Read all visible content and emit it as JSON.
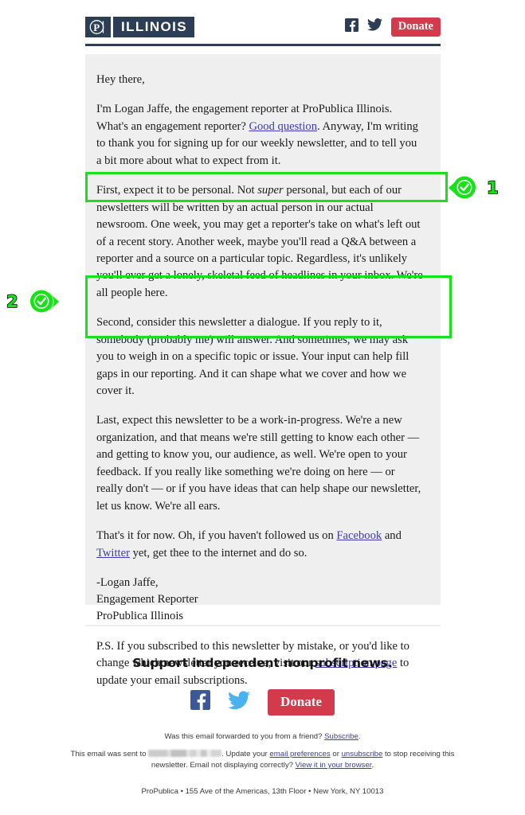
{
  "header": {
    "logo_mark": "propublica-p-logo",
    "logo_word": "ILLINOIS",
    "facebook_icon": "facebook-icon",
    "twitter_icon": "twitter-icon",
    "donate_label": "Donate"
  },
  "letter": {
    "greeting": "Hey there,",
    "p1_a": "I'm Logan Jaffe, the engagement reporter at ProPublica Illinois. What's an engagement reporter? ",
    "p1_link": "Good question",
    "p1_b": ". Anyway, I'm writing to thank you for signing up for our weekly newsletter, and to tell you a bit more about what to expect from it.",
    "p2_a": "First, expect it to be personal. Not ",
    "p2_em": "super",
    "p2_b": " personal, but each of our newsletters will be written by an actual person in our actual newsroom. One week, you may get a reporter's take on what's left out of a recent story. Another week, maybe you'll read a Q&A between a reporter and a source on a particular topic. Regardless, it's unlikely you'll ever get a lonely, skeletal feed of headlines in your inbox. We're all people here.",
    "p3": "Second, consider this newsletter a dialogue. If you reply to it, somebody (probably me) will answer. And sometimes, we may ask you to weigh in on a specific topic or issue. Your input can help fill gaps in our reporting. And it can shape what we cover and how we cover it.",
    "p4": "Last, expect this newsletter to be a work-in-progress. We're a new organization, and that means we're still getting to know each other — and getting to know you, our audience, as well. We're open to your feedback. If you really like something we're doing on here — or really don't — or if you have ideas that can help shape our newsletter, let us know. We're all ears.",
    "p5_a": "That's it for now. Oh, if you haven't followed us on ",
    "p5_fb": "Facebook",
    "p5_and": " and ",
    "p5_tw": "Twitter",
    "p5_b": " yet, get thee to the internet and do so.",
    "sig_name": "-Logan Jaffe,",
    "sig_title": "Engagement Reporter",
    "sig_org": "ProPublica Illinois",
    "ps_a": "P.S. If you subscribed to this newsletter by mistake, or you'd like to change which newsletter you receive, visit our ",
    "ps_link": "subscription page",
    "ps_b": " to update your email subscriptions."
  },
  "annotations": [
    {
      "number": "1",
      "icon": "check-circle-icon",
      "color": "#17e217"
    },
    {
      "number": "2",
      "icon": "check-circle-icon",
      "color": "#17e217"
    }
  ],
  "support": {
    "title": "Support independent nonprofit news.",
    "facebook_icon": "facebook-icon",
    "twitter_icon": "twitter-icon",
    "donate_label": "Donate"
  },
  "fineprint": {
    "line1_a": "Was this email forwarded to you from a friend? ",
    "line1_link": "Subscribe",
    "line1_b": ".",
    "line2_a": "This email was sent to ",
    "line2_redacted": "redacted-email-address",
    "line2_b": ". Update your ",
    "line2_link1": "email preferences",
    "line2_c": " or ",
    "line2_link2": "unsubscribe",
    "line2_d": " to stop receiving this newsletter. Email not displaying correctly? ",
    "line2_link3": "View it in your browser",
    "line2_e": ".",
    "address": "ProPublica • 155 Ave of the Americas, 13th Floor • New York, NY 10013"
  },
  "colors": {
    "navy": "#2c3d56",
    "donate_red": "#d33a4b",
    "panel_gray": "#efefef",
    "link_blue": "#3b3bb3",
    "annotation_green": "#17e217",
    "twitter_blue": "#4ab3ef",
    "facebook_blue": "#3b5998"
  }
}
